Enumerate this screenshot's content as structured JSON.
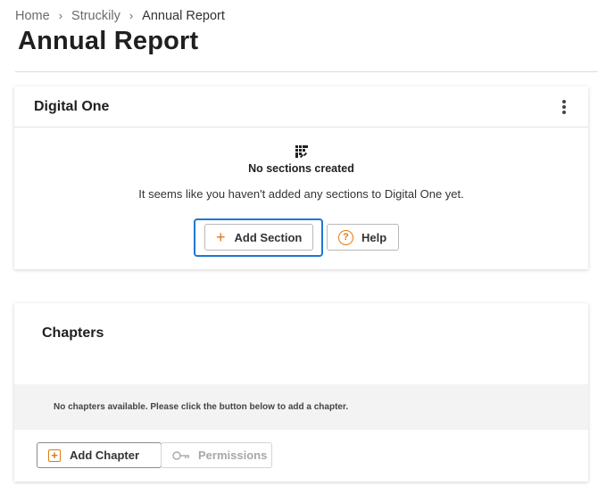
{
  "breadcrumb": {
    "items": [
      "Home",
      "Struckily",
      "Annual Report"
    ],
    "separator_icon": "chevron-right-icon"
  },
  "page": {
    "title": "Annual Report"
  },
  "digital_one_card": {
    "title": "Digital One",
    "menu_icon": "kebab-menu-icon",
    "empty_state": {
      "icon": "grid-dots-icon",
      "title": "No sections created",
      "description": "It seems like you haven't added any sections to Digital One yet."
    },
    "add_section_label": "Add Section",
    "help_label": "Help"
  },
  "chapters_card": {
    "title": "Chapters",
    "empty_message": "No chapters available. Please click the button below to add a chapter.",
    "add_chapter_label": "Add Chapter",
    "permissions_label": "Permissions",
    "permissions_disabled": true
  },
  "colors": {
    "accent_orange": "#e07a10",
    "focus_blue": "#1f77d0"
  }
}
